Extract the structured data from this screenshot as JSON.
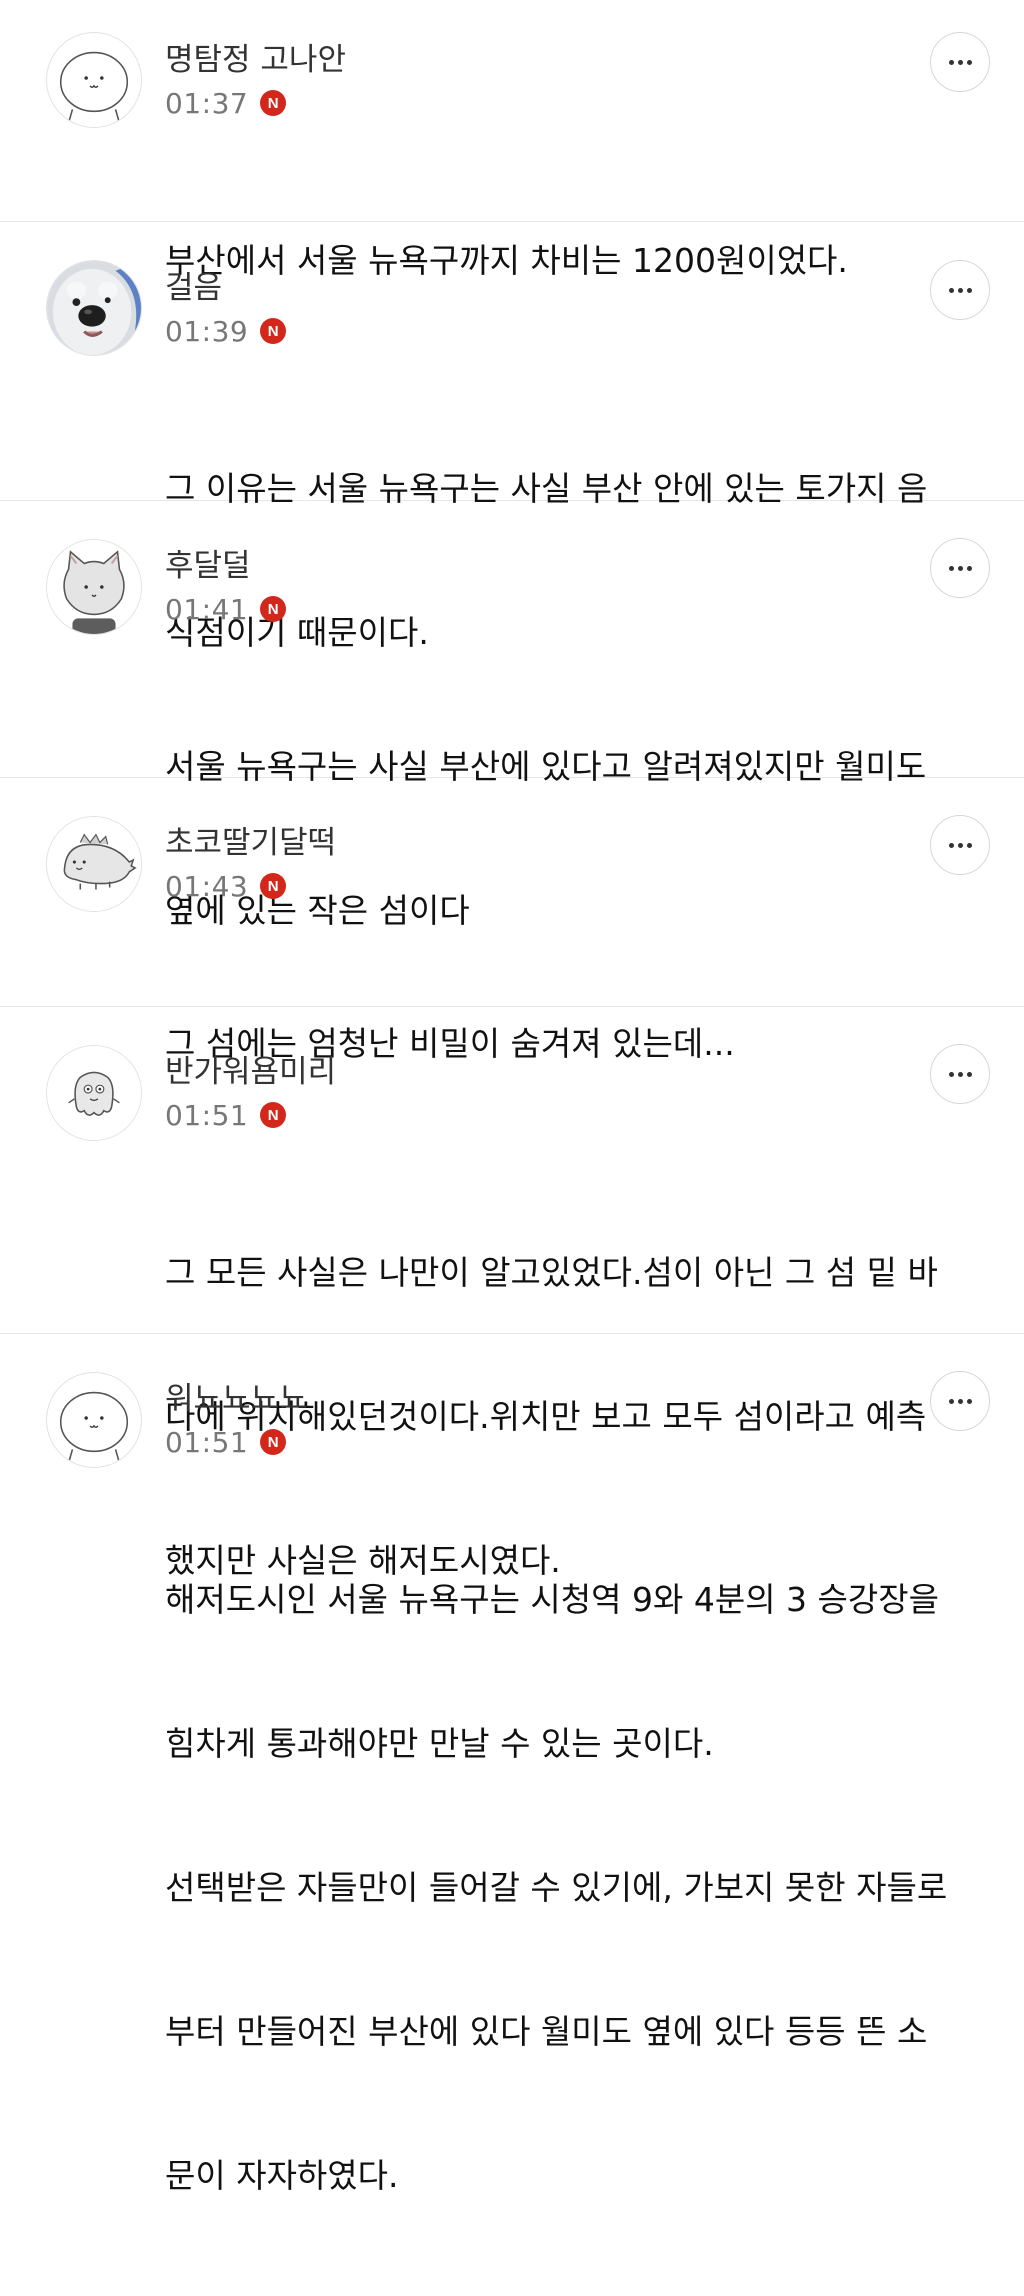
{
  "comments": [
    {
      "author": "명탐정 고나안",
      "time": "01:37",
      "badge": "N",
      "avatar": "round-face-avatar-icon",
      "lines": [
        "부산에서 서울 뉴욕구까지 차비는 1200원이었다."
      ]
    },
    {
      "author": "걸음",
      "time": "01:39",
      "badge": "N",
      "avatar": "dog-photo-avatar",
      "lines": [
        "그 이유는 서울 뉴욕구는 사실 부산 안에 있는 토가지 음",
        "식점이기 때문이다."
      ]
    },
    {
      "author": "후달덜",
      "time": "01:41",
      "badge": "N",
      "avatar": "cat-face-avatar-icon",
      "lines": [
        "서울 뉴욕구는 사실 부산에 있다고 알려져있지만 월미도",
        "옆에 있는 작은 섬이다"
      ]
    },
    {
      "author": "초코딸기달떡",
      "time": "01:43",
      "badge": "N",
      "avatar": "dinosaur-avatar-icon",
      "lines": [
        "그 섬에는 엄청난 비밀이 숨겨져 있는데..."
      ]
    },
    {
      "author": "반가워욤미리",
      "time": "01:51",
      "badge": "N",
      "avatar": "ghost-avatar-icon",
      "lines": [
        "그 모든 사실은 나만이 알고있었다.섬이 아닌 그 섬 밑 바",
        "다에 위치해있던것이다.위치만 보고 모두 섬이라고 예측",
        "했지만 사실은 해저도시였다."
      ]
    },
    {
      "author": "워뇨뇨뇨뇨",
      "time": "01:51",
      "badge": "N",
      "avatar": "round-face-avatar-icon",
      "lines": [
        "해저도시인 서울 뉴욕구는 시청역 9와 4분의 3 승강장을",
        "힘차게 통과해야만 만날 수 있는 곳이다.",
        "선택받은 자들만이 들어갈 수 있기에, 가보지 못한 자들로",
        "부터 만들어진 부산에 있다 월미도 옆에 있다 등등 뜬 소",
        "문이 자자하였다."
      ]
    }
  ],
  "colors": {
    "badge": "#d3271b",
    "author": "#333333",
    "time": "#777777",
    "divider": "#e6e6e6"
  }
}
